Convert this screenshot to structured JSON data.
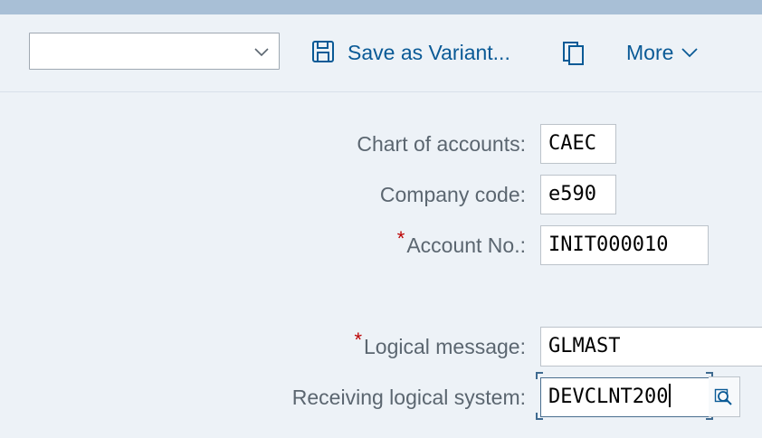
{
  "toolbar": {
    "variant_value": "",
    "save_variant_label": "Save as Variant...",
    "more_label": "More",
    "icons": [
      "chevron-down-icon",
      "save-icon",
      "copy-icon",
      "chevron-down-icon"
    ]
  },
  "form": {
    "chart_of_accounts": {
      "label": "Chart of accounts:",
      "value": "CAEC"
    },
    "company_code": {
      "label": "Company code:",
      "value": "e590"
    },
    "account_no": {
      "label": "Account No.:",
      "value": "INIT000010",
      "required": true
    },
    "logical_message": {
      "label": "Logical message:",
      "value": "GLMAST",
      "required": true
    },
    "receiving_system": {
      "label": "Receiving logical system:",
      "value": "DEVCLNT200",
      "icon": "value-help-icon"
    }
  },
  "required_mark": "*",
  "colors": {
    "accent": "#0a5a96",
    "top_bar": "#a8bfd6",
    "background": "#edf2f7",
    "required": "#bb0000"
  }
}
